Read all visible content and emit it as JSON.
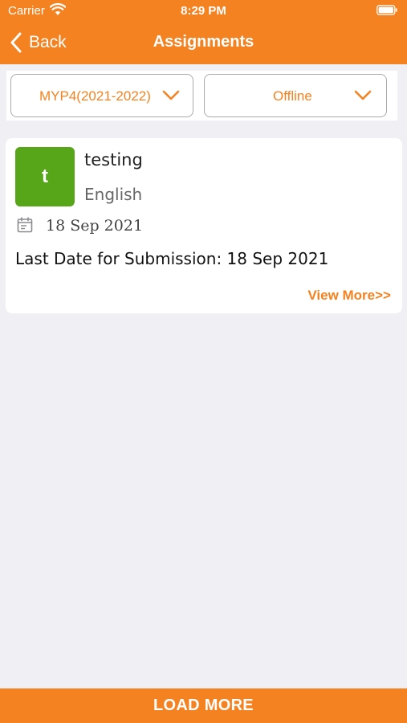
{
  "status_bar": {
    "carrier": "Carrier",
    "time": "8:29 PM"
  },
  "nav": {
    "back_label": "Back",
    "title": "Assignments"
  },
  "filters": {
    "year": "MYP4(2021-2022)",
    "mode": "Offline"
  },
  "assignments": [
    {
      "avatar_letter": "t",
      "avatar_color": "#57a519",
      "title": "testing",
      "subject": "English",
      "date": "18 Sep 2021",
      "deadline": "Last Date for Submission: 18 Sep 2021",
      "view_more_label": "View More>>"
    }
  ],
  "footer": {
    "load_more_label": "LOAD MORE"
  },
  "colors": {
    "accent": "#f58220",
    "background": "#efeff4",
    "card": "#ffffff"
  },
  "icons": [
    "wifi-icon",
    "battery-icon",
    "back-icon",
    "chevron-down-icon",
    "calendar-icon"
  ]
}
